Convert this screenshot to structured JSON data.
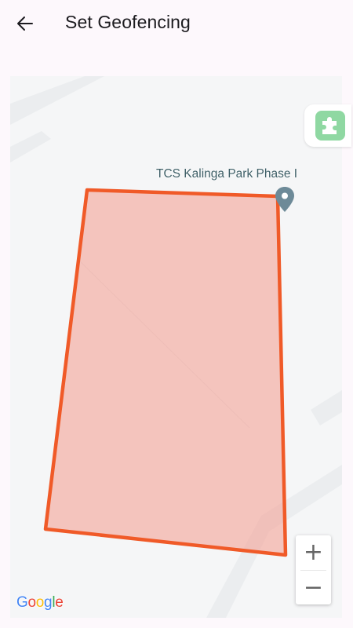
{
  "app_bar": {
    "back_icon": "arrow-left-icon",
    "title": "Set Geofencing"
  },
  "map": {
    "place_label": "TCS Kalinga Park Phase I",
    "place_pin_icon": "map-pin-icon",
    "plugin_icon": "puzzle-piece-icon",
    "zoom_in_label": "+",
    "zoom_out_label": "−",
    "attribution": {
      "letters": [
        "G",
        "o",
        "o",
        "g",
        "l",
        "e"
      ],
      "colors": [
        "#4285f4",
        "#ea4335",
        "#fbbc05",
        "#4285f4",
        "#34a853",
        "#ea4335"
      ]
    },
    "geofence": {
      "stroke_color": "#f05a28",
      "fill_color": "#f4a59a"
    },
    "colors": {
      "background": "#f5f6f7",
      "roads": "#e8eaec",
      "pin": "#6d8a98",
      "plugin_chip": "#8fd8a2"
    }
  }
}
